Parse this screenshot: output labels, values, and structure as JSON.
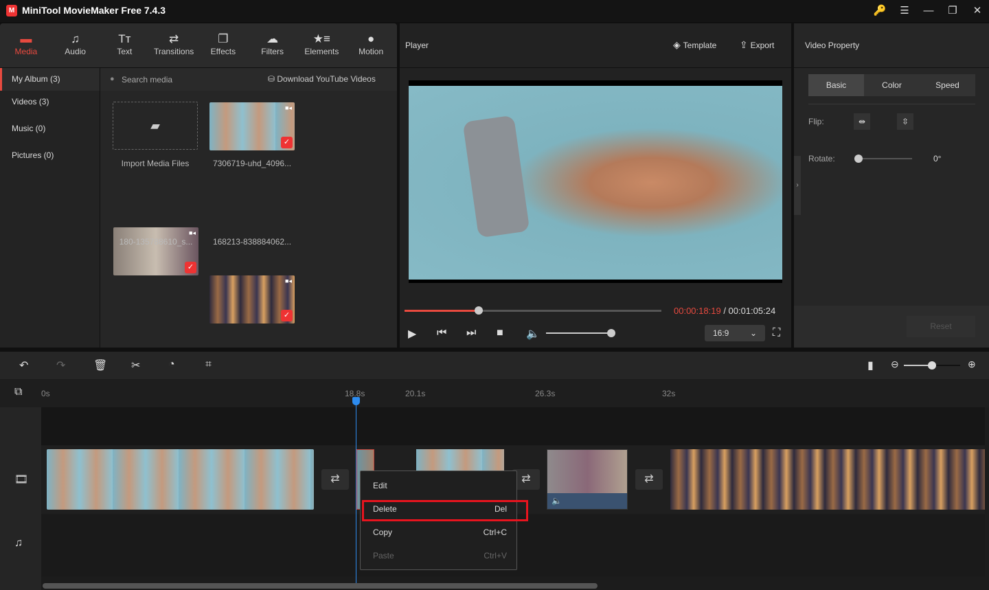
{
  "app": {
    "title": "MiniTool MovieMaker Free 7.4.3",
    "logo_text": "M"
  },
  "window_controls": [
    {
      "icon": "key-icon",
      "g": "🔑"
    },
    {
      "icon": "menu-icon",
      "g": "☰"
    },
    {
      "icon": "minimize-icon",
      "g": "—"
    },
    {
      "icon": "maximize-icon",
      "g": "❐"
    },
    {
      "icon": "close-icon",
      "g": "✕"
    }
  ],
  "toolbar": [
    {
      "label": "Media",
      "icon": "folder-icon",
      "g": "▬"
    },
    {
      "label": "Audio",
      "icon": "music-icon",
      "g": "♫"
    },
    {
      "label": "Text",
      "icon": "text-icon",
      "g": "Tт"
    },
    {
      "label": "Transitions",
      "icon": "transition-icon",
      "g": "⇄"
    },
    {
      "label": "Effects",
      "icon": "effects-icon",
      "g": "❐"
    },
    {
      "label": "Filters",
      "icon": "filters-icon",
      "g": "☁"
    },
    {
      "label": "Elements",
      "icon": "elements-icon",
      "g": "★≡"
    },
    {
      "label": "Motion",
      "icon": "motion-icon",
      "g": "●"
    }
  ],
  "sidebar": [
    {
      "label": "My Album (3)"
    },
    {
      "label": "Videos (3)"
    },
    {
      "label": "Music (0)"
    },
    {
      "label": "Pictures (0)"
    }
  ],
  "media": {
    "search_placeholder": "Search media",
    "download_label": "Download YouTube Videos",
    "import_label": "Import Media Files",
    "items": [
      {
        "name": "7306719-uhd_4096..."
      },
      {
        "name": "180-135788610_s..."
      },
      {
        "name": "168213-838884062..."
      }
    ]
  },
  "player": {
    "title": "Player",
    "template_label": "Template",
    "export_label": "Export",
    "current_time": "00:00:18:19",
    "total_time": "/ 00:01:05:24",
    "progress": 0.29,
    "volume": 1.0,
    "aspect": "16:9"
  },
  "property": {
    "title": "Video Property",
    "tabs": [
      "Basic",
      "Color",
      "Speed"
    ],
    "active_tab": "Basic",
    "flip_label": "Flip:",
    "rotate_label": "Rotate:",
    "rotate_value": "0°",
    "reset_label": "Reset"
  },
  "timeline": {
    "ruler": [
      "0s",
      "18.8s",
      "20.1s",
      "26.3s",
      "32s"
    ],
    "zoom_level": 0.5
  },
  "context_menu": [
    {
      "label": "Edit",
      "shortcut": ""
    },
    {
      "label": "Delete",
      "shortcut": "Del"
    },
    {
      "label": "Copy",
      "shortcut": "Ctrl+C"
    },
    {
      "label": "Paste",
      "shortcut": "Ctrl+V"
    }
  ],
  "colors": {
    "accent": "#e84a3f",
    "playhead": "#2d8cf0",
    "highlight": "#e8141e"
  }
}
